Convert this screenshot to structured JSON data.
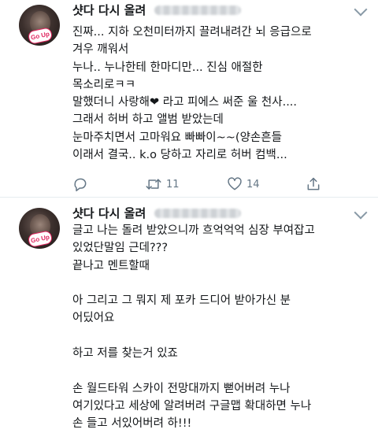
{
  "tweets": [
    {
      "author_name": "샷다 다시 올려",
      "avatar_badge": "Go Up",
      "lines": [
        "진짜... 지하 오천미터까지 끌려내려간 뇌 응급으로",
        "겨우 깨워서",
        "누나.. 누나한테 한마디만... 진심 애절한",
        "목소리로ㅋㅋ",
        "말했더니 사랑해❤ 라고 피에스 써준 울 천사....",
        "그래서 허버 하고 앨범 받았는데",
        "눈마주치면서 고마워요 빠빠이~~(양손흔들",
        "이래서 결국.. k.o 당하고 자리로 허버 컴백..."
      ],
      "actions": {
        "reply_count": "",
        "retweet_count": "11",
        "like_count": "14"
      }
    },
    {
      "author_name": "샷다 다시 올려",
      "avatar_badge": "Go Up",
      "lines": [
        "글고 나는 돌려 받았으니까 흐억억억 심장 부여잡고",
        "있었단말임 근데???",
        "끝나고 멘트할때",
        "",
        "아 그리고 그 뭐지 제 포카 드디어 받아가신 분",
        "어딨어요",
        "",
        "하고 저를 찾는거 있죠",
        "",
        "손 월드타워 스카이 전망대까지 뻗어버려 누나",
        "여기있다고 세상에 알려버려 구글맵 확대하면 누나",
        "손 들고 서있어버려 하!!!"
      ]
    }
  ]
}
